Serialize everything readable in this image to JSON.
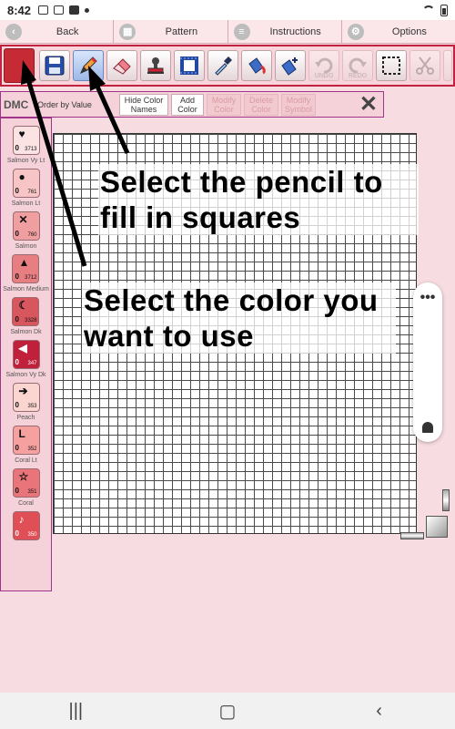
{
  "status_bar": {
    "time": "8:42"
  },
  "nav_tabs": [
    {
      "label": "Back",
      "icon": "chevron-left-icon",
      "glyph": "‹"
    },
    {
      "label": "Pattern",
      "icon": "grid-icon",
      "glyph": "▦"
    },
    {
      "label": "Instructions",
      "icon": "list-icon",
      "glyph": "≡"
    },
    {
      "label": "Options",
      "icon": "gear-icon",
      "glyph": "⚙"
    }
  ],
  "toolbar": {
    "selected_color": "#c62a35",
    "undo_label": "UNDO",
    "redo_label": "REDO"
  },
  "palette_bar": {
    "brand": "DMC",
    "order_label": "Order by Value",
    "hide_label": "Hide Color Names",
    "add_label": "Add Color",
    "modify_label": "Modify Color",
    "delete_label": "Delete Color",
    "modify_symbol_label": "Modify Symbol"
  },
  "palette": [
    {
      "symbol": "♥",
      "count": "0",
      "number": "3713",
      "name": "Salmon Vy Lt",
      "color": "#fbe3e4",
      "dark": false
    },
    {
      "symbol": "●",
      "count": "0",
      "number": "761",
      "name": "Salmon Lt",
      "color": "#f7c5c5",
      "dark": false
    },
    {
      "symbol": "✕",
      "count": "0",
      "number": "760",
      "name": "Salmon",
      "color": "#f09fa0",
      "dark": false
    },
    {
      "symbol": "▲",
      "count": "0",
      "number": "3712",
      "name": "Salmon Medium",
      "color": "#e77f82",
      "dark": false
    },
    {
      "symbol": "☾",
      "count": "0",
      "number": "3328",
      "name": "Salmon Dk",
      "color": "#d8575e",
      "dark": false
    },
    {
      "symbol": "◀",
      "count": "0",
      "number": "347",
      "name": "Salmon Vy Dk",
      "color": "#c0203a",
      "dark": true
    },
    {
      "symbol": "➔",
      "count": "0",
      "number": "353",
      "name": "Peach",
      "color": "#fbd5cf",
      "dark": false
    },
    {
      "symbol": "L",
      "count": "0",
      "number": "352",
      "name": "Coral Lt",
      "color": "#f7a0a0",
      "dark": false
    },
    {
      "symbol": "☆",
      "count": "0",
      "number": "351",
      "name": "Coral",
      "color": "#e97479",
      "dark": false
    },
    {
      "symbol": "♪",
      "count": "0",
      "number": "350",
      "name": "",
      "color": "#df4f55",
      "dark": true
    }
  ],
  "annotations": {
    "pencil": "Select the pencil to fill in squares",
    "color": "Select the color you want to use"
  },
  "floating_panel": {
    "more": "•••"
  }
}
